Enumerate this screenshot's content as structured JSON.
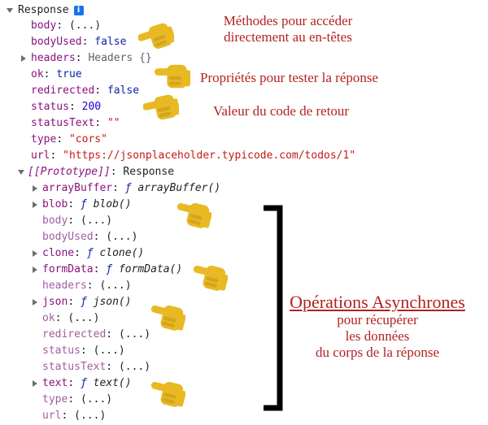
{
  "root": {
    "label": "Response",
    "info_icon": "info-icon",
    "info_glyph": "i"
  },
  "props": [
    {
      "key": "body",
      "value": "(...)",
      "type": "plain"
    },
    {
      "key": "bodyUsed",
      "value": "false",
      "type": "kw"
    },
    {
      "key": "headers",
      "value": "Headers {}",
      "type": "muted"
    },
    {
      "key": "ok",
      "value": "true",
      "type": "kw"
    },
    {
      "key": "redirected",
      "value": "false",
      "type": "kw"
    },
    {
      "key": "status",
      "value": "200",
      "type": "num"
    },
    {
      "key": "statusText",
      "value": "\"\"",
      "type": "str"
    },
    {
      "key": "type",
      "value": "\"cors\"",
      "type": "str"
    },
    {
      "key": "url",
      "value": "\"https://jsonplaceholder.typicode.com/todos/1\"",
      "type": "str"
    }
  ],
  "prototype": {
    "label": "[[Prototype]]",
    "value": "Response",
    "members": [
      {
        "key": "arrayBuffer",
        "f": "ƒ",
        "fname": "arrayBuffer()"
      },
      {
        "key": "blob",
        "f": "ƒ",
        "fname": "blob()"
      },
      {
        "key": "body",
        "value": "(...)"
      },
      {
        "key": "bodyUsed",
        "value": "(...)"
      },
      {
        "key": "clone",
        "f": "ƒ",
        "fname": "clone()"
      },
      {
        "key": "formData",
        "f": "ƒ",
        "fname": "formData()"
      },
      {
        "key": "headers",
        "value": "(...)"
      },
      {
        "key": "json",
        "f": "ƒ",
        "fname": "json()"
      },
      {
        "key": "ok",
        "value": "(...)"
      },
      {
        "key": "redirected",
        "value": "(...)"
      },
      {
        "key": "status",
        "value": "(...)"
      },
      {
        "key": "statusText",
        "value": "(...)"
      },
      {
        "key": "text",
        "f": "ƒ",
        "fname": "text()"
      },
      {
        "key": "type",
        "value": "(...)"
      },
      {
        "key": "url",
        "value": "(...)"
      }
    ]
  },
  "annotations": {
    "methods_line1": "Méthodes pour  accéder",
    "methods_line2": "directement au en-têtes",
    "props": "Propriétés pour tester la réponse",
    "status": "Valeur du code de retour",
    "async_title": "Opérations Asynchrones",
    "async_line1": "pour récupérer",
    "async_line2": "les données",
    "async_line3": "du corps de la réponse"
  },
  "colors": {
    "annotation": "#b22222",
    "hand": "#e8b923",
    "key": "#881280",
    "string": "#c41a16",
    "number": "#1c00cf",
    "keyword": "#0d22aa"
  }
}
